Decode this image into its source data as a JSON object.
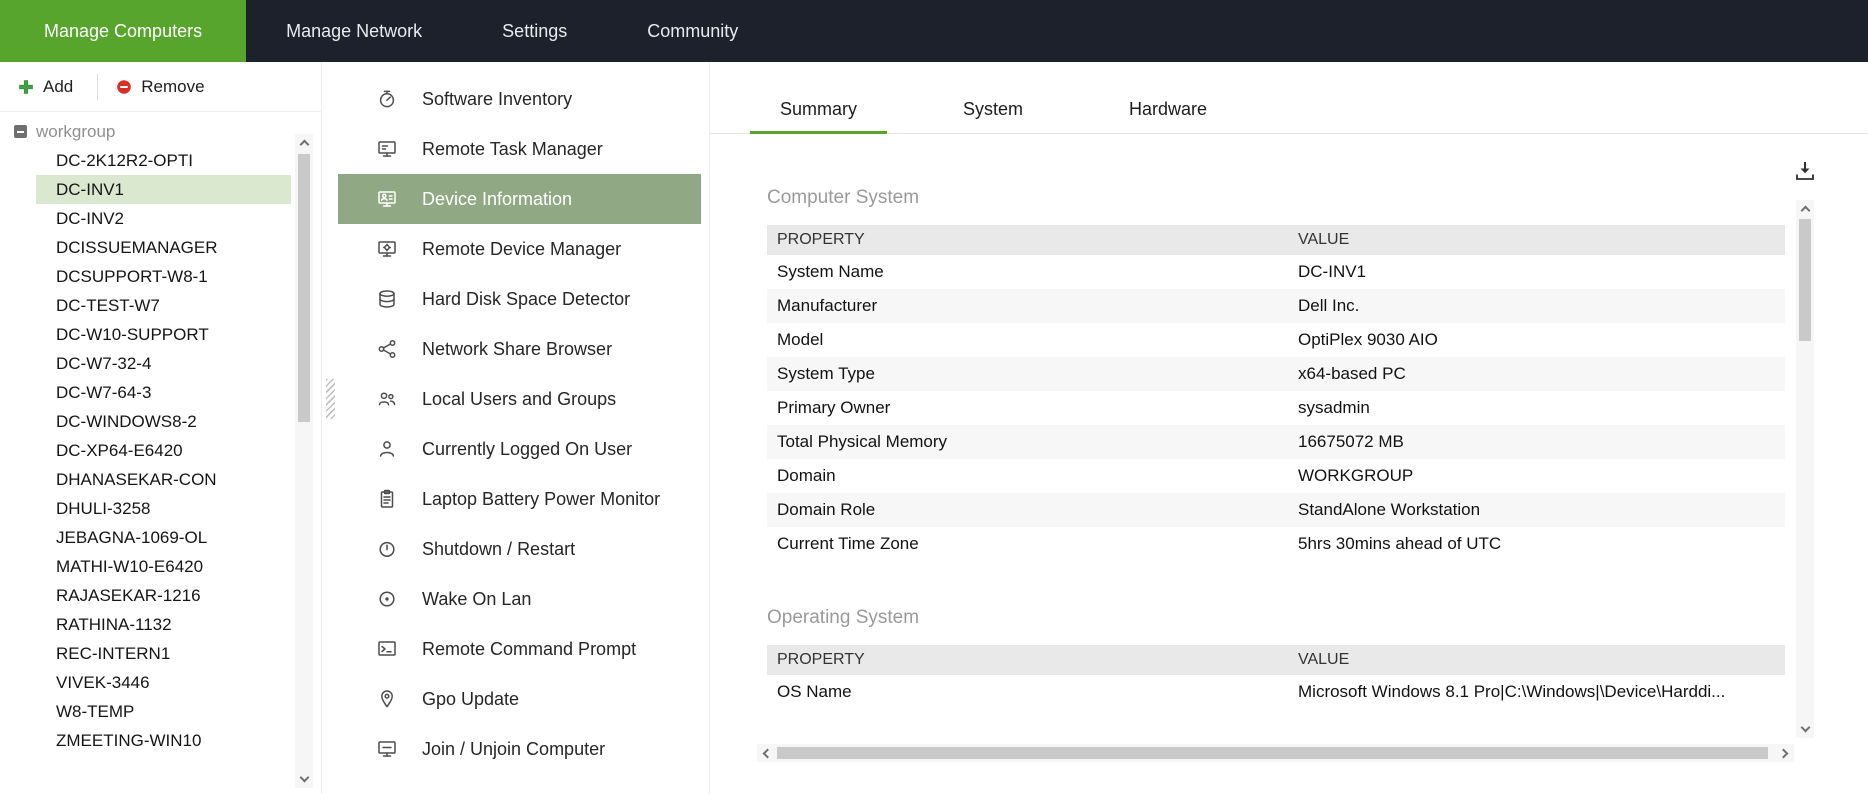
{
  "topnav": {
    "tabs": [
      {
        "label": "Manage Computers",
        "active": true
      },
      {
        "label": "Manage Network",
        "active": false
      },
      {
        "label": "Settings",
        "active": false
      },
      {
        "label": "Community",
        "active": false
      }
    ]
  },
  "sidebar": {
    "add_label": "Add",
    "remove_label": "Remove",
    "tree": {
      "root_label": "workgroup",
      "selected": "DC-INV1",
      "computers": [
        "DC-2K12R2-OPTI",
        "DC-INV1",
        "DC-INV2",
        "DCISSUEMANAGER",
        "DCSUPPORT-W8-1",
        "DC-TEST-W7",
        "DC-W10-SUPPORT",
        "DC-W7-32-4",
        "DC-W7-64-3",
        "DC-WINDOWS8-2",
        "DC-XP64-E6420",
        "DHANASEKAR-CON",
        "DHULI-3258",
        "JEBAGNA-1069-OL",
        "MATHI-W10-E6420",
        "RAJASEKAR-1216",
        "RATHINA-1132",
        "REC-INTERN1",
        "VIVEK-3446",
        "W8-TEMP",
        "ZMEETING-WIN10"
      ]
    }
  },
  "tools_menu": {
    "items": [
      {
        "label": "Software Inventory",
        "icon": "software-inventory-icon",
        "active": false
      },
      {
        "label": "Remote Task Manager",
        "icon": "remote-task-manager-icon",
        "active": false
      },
      {
        "label": "Device Information",
        "icon": "device-information-icon",
        "active": true
      },
      {
        "label": "Remote Device Manager",
        "icon": "remote-device-manager-icon",
        "active": false
      },
      {
        "label": "Hard Disk Space Detector",
        "icon": "hard-disk-icon",
        "active": false
      },
      {
        "label": "Network Share Browser",
        "icon": "network-share-icon",
        "active": false
      },
      {
        "label": "Local Users and Groups",
        "icon": "users-group-icon",
        "active": false
      },
      {
        "label": "Currently Logged On User",
        "icon": "user-icon",
        "active": false
      },
      {
        "label": "Laptop Battery Power Monitor",
        "icon": "battery-monitor-icon",
        "active": false
      },
      {
        "label": "Shutdown / Restart",
        "icon": "power-icon",
        "active": false
      },
      {
        "label": "Wake On Lan",
        "icon": "wake-on-lan-icon",
        "active": false
      },
      {
        "label": "Remote Command Prompt",
        "icon": "command-prompt-icon",
        "active": false
      },
      {
        "label": "Gpo Update",
        "icon": "location-pin-icon",
        "active": false
      },
      {
        "label": "Join / Unjoin Computer",
        "icon": "join-computer-icon",
        "active": false
      }
    ]
  },
  "main": {
    "tabs": [
      {
        "label": "Summary",
        "active": true
      },
      {
        "label": "System",
        "active": false
      },
      {
        "label": "Hardware",
        "active": false
      }
    ],
    "export_icon": "download-icon",
    "sections": [
      {
        "title": "Computer System",
        "columns": [
          "PROPERTY",
          "VALUE"
        ],
        "rows": [
          [
            "System Name",
            "DC-INV1"
          ],
          [
            "Manufacturer",
            "Dell Inc."
          ],
          [
            "Model",
            "OptiPlex 9030 AIO"
          ],
          [
            "System Type",
            "x64-based PC"
          ],
          [
            "Primary Owner",
            "sysadmin"
          ],
          [
            "Total Physical Memory",
            "16675072 MB"
          ],
          [
            "Domain",
            "WORKGROUP"
          ],
          [
            "Domain Role",
            "StandAlone Workstation"
          ],
          [
            "Current Time Zone",
            "5hrs 30mins ahead of UTC"
          ]
        ]
      },
      {
        "title": "Operating System",
        "columns": [
          "PROPERTY",
          "VALUE"
        ],
        "rows": [
          [
            "OS Name",
            "Microsoft Windows 8.1 Pro|C:\\Windows|\\Device\\Harddi..."
          ]
        ]
      }
    ]
  },
  "colors": {
    "accent_green": "#58a52e",
    "selected_menu_green": "#90a884",
    "selected_tree_green": "#d9e8ce",
    "topbar_dark": "#1c212b",
    "remove_red": "#d93025",
    "table_header_gray": "#e9e9e9"
  }
}
